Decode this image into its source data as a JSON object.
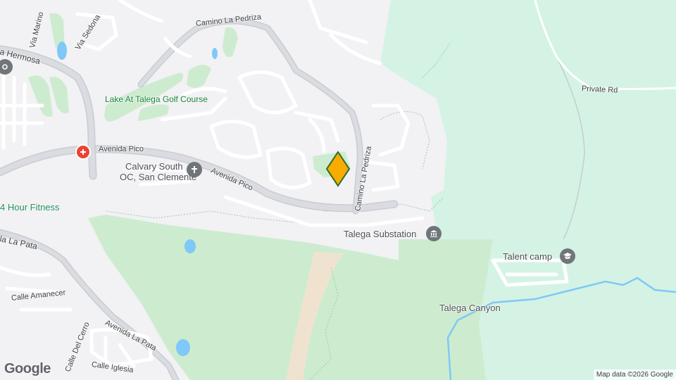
{
  "map": {
    "attribution": "Map data ©2026 Google",
    "logo_text": "Google",
    "colors": {
      "land": "#f2f1f4",
      "park": "#cdeccf",
      "open_space": "#d4f3e4",
      "road": "#ffffff",
      "road_casing": "#c8ccd4",
      "highway": "#dadce0",
      "water": "#7fc8f8",
      "trail": "#9ccab0",
      "dirt": "#efe3cf",
      "marker": "#f9ab00"
    },
    "roads": {
      "camino_la_pedriza_top": "Camino La Pedriza",
      "camino_la_pedriza_side": "Camino La Pedriza",
      "avenida_pico_left": "Avenida Pico",
      "avenida_pico_right": "Avenida Pico",
      "via_marino": "Via Marino",
      "via_sedona": "Via Sedona",
      "la_hermosa": "a Hermosa",
      "private_rd": "Private Rd",
      "la_pata": "la La Pata",
      "calle_amanecer": "Calle Amanecer",
      "avenida_la_pata": "Avenida La Pata",
      "calle_del_cerro": "Calle Del Cerro",
      "calle_iglesia": "Calle Iglesia"
    },
    "places": {
      "golf_course": "Lake At Talega Golf Course",
      "calvary_line1": "Calvary South",
      "calvary_line2": "OC, San Clemente",
      "fitness": "4 Hour Fitness",
      "substation": "Talega Substation",
      "talent_camp": "Talent camp",
      "canyon": "Talega Canyon"
    },
    "icons": {
      "hospital": "hospital-icon",
      "church": "church-icon",
      "government": "landmark-icon",
      "school": "graduation-cap-icon",
      "location": "location-pin-icon",
      "marker": "selected-location-marker"
    }
  }
}
